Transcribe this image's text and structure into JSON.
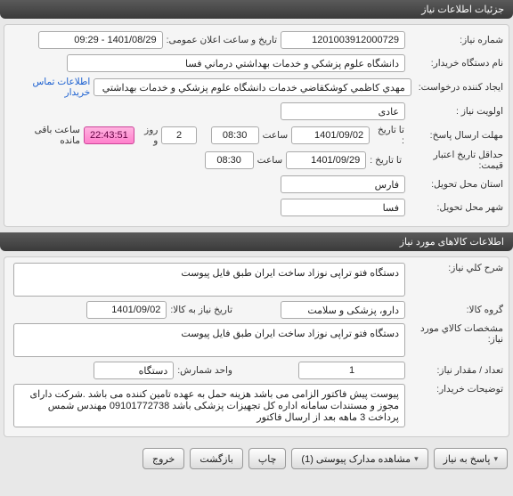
{
  "headers": {
    "need_info": "جزئیات اطلاعات نیاز",
    "items_info": "اطلاعات کالاهای مورد نیاز"
  },
  "need": {
    "number_label": "شماره نیاز:",
    "number": "1201003912000729",
    "announce_label": "تاریخ و ساعت اعلان عمومی:",
    "announce_value": "1401/08/29 - 09:29",
    "buyer_org_label": "نام دستگاه خریدار:",
    "buyer_org": "دانشگاه علوم پزشکي و خدمات بهداشتي درماني فسا",
    "creator_label": "ایجاد کننده درخواست:",
    "creator": "مهدي  کاظمي کوشکقاضي خدمات دانشگاه علوم پزشکي و خدمات بهداشتي",
    "contact_link": "اطلاعات تماس خریدار",
    "priority_label": "اولویت نیاز :",
    "priority": "عادی",
    "deadline_label": "مهلت ارسال پاسخ:",
    "until_label": "تا تاریخ :",
    "deadline_date": "1401/09/02",
    "time_label": "ساعت",
    "deadline_time": "08:30",
    "days_count": "2",
    "days_text": "روز و",
    "timer": "22:43:51",
    "remaining_text": "ساعت باقی مانده",
    "validity_label": "حداقل تاریخ اعتبار قیمت:",
    "validity_date": "1401/09/29",
    "validity_time": "08:30",
    "province_label": "استان محل تحویل:",
    "province": "فارس",
    "city_label": "شهر محل تحویل:",
    "city": "فسا"
  },
  "items": {
    "desc_label": "شرح کلي نیاز:",
    "desc": "دستگاه فتو تراپی نوزاد ساخت ایران طبق فایل پیوست",
    "group_label": "گروه کالا:",
    "group": "دارو، پزشکی و سلامت",
    "need_date_label": "تاریخ نیاز به کالا:",
    "need_date": "1401/09/02",
    "spec_label": "مشخصات کالاي مورد نیاز:",
    "spec": "دستگاه فتو تراپی نوزاد ساخت ایران طبق فایل پیوست",
    "qty_label": "تعداد / مقدار نیاز:",
    "qty": "1",
    "unit_label": "واحد شمارش:",
    "unit": "دستگاه",
    "buyer_notes_label": "توضیحات خریدار:",
    "buyer_notes": "پیوست پیش فاکتور الزامی می باشد هزینه حمل به عهده تامین کننده می باشد .شرکت دارای مجوز و مستندات سامانه اداره کل  تجهیزات پزشکی باشد 09101772738 مهندس شمس پرداخت 3 ماهه بعد از ارسال فاکتور"
  },
  "buttons": {
    "respond": "پاسخ به نیاز",
    "attachments": "مشاهده مدارک پیوستی  (1)",
    "print": "چاپ",
    "back": "بازگشت",
    "exit": "خروج"
  }
}
